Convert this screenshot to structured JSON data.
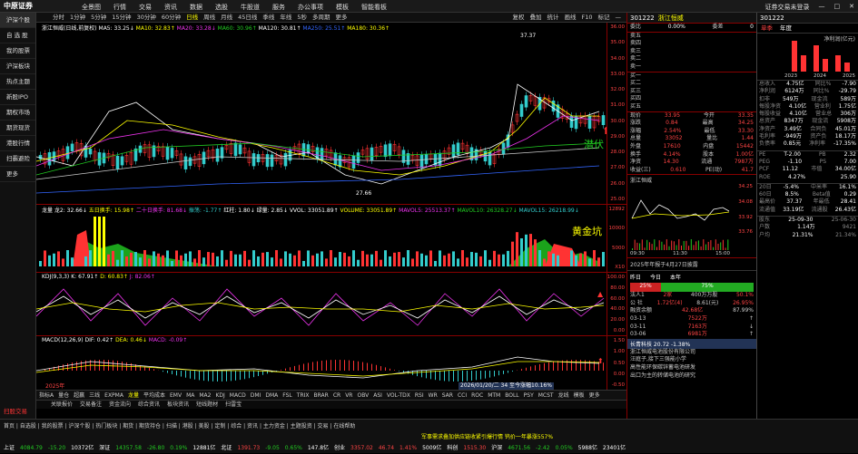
{
  "app": {
    "brand": "中原证券",
    "menu": [
      "全景图",
      "行情",
      "交易",
      "资讯",
      "数据",
      "选股",
      "牛股道",
      "服务",
      "办公事项",
      "模板",
      "智能看板"
    ],
    "right": [
      "证券交易未登录",
      "—",
      "□",
      "✕"
    ]
  },
  "sidebar": {
    "items": [
      "沪深个股",
      "自 选 股",
      "我的股票",
      "沪深板块",
      "热点主题",
      "新股IPO",
      "期权市场",
      "期货现货",
      "港股行情",
      "扫霸避险",
      "更多"
    ],
    "bottom_label": "扫股交易"
  },
  "tabs": {
    "items": [
      "分时",
      "1分钟",
      "5分钟",
      "15分钟",
      "30分钟",
      "60分钟",
      "日线",
      "周线",
      "月线",
      "45日线",
      "季线",
      "年线",
      "5秒",
      "多周期",
      "更多"
    ],
    "selected": "日线",
    "tools": [
      "复权",
      "叠加",
      "统计",
      "画线",
      "F10",
      "标记",
      "—"
    ]
  },
  "main_legend": {
    "title": "浙江恒威(日线,前复权)",
    "ma5": "MA5: 33.25↓",
    "ma10": "MA10: 32.83↑",
    "ma20": "MA20: 33.28↓",
    "ma60": "MA60: 30.96↑",
    "ma120": "MA120: 30.81↑",
    "ma250": "MA250: 25.51↑",
    "ma180": "MA180: 30.36↑"
  },
  "main_annot": {
    "high": "37.37",
    "low": "27.66",
    "label": "潜伏"
  },
  "main_axis": [
    "36.00",
    "35.00",
    "34.00",
    "33.00",
    "32.00",
    "31.00",
    "30.00",
    "29.00",
    "28.00",
    "27.00",
    "26.00",
    "25.00"
  ],
  "vol_legend": {
    "a": "龙量 龙2: 32.66↓",
    "b": "五日换手: 15.98↑",
    "c": "二十日换手: 81.68↓",
    "d": "振荡: -1.77↑",
    "e": "红柱: 1.80↓",
    "f": "绿量: 2.85↓",
    "g": "VVOL: 33051.89↑",
    "h": "VOLUME: 33051.89↑",
    "i": "MAVOL5: 25513.37↑",
    "j": "MAVOL10: 26328.27↓",
    "k": "MAVOL15: 26218.99↓"
  },
  "vol_annot": "黄金坑",
  "vol_axis": [
    "12892",
    "10000",
    "5000",
    "X10"
  ],
  "kdj_legend": {
    "t": "KDJ(9,3,3)",
    "k": "K: 67.91↑",
    "d": "D: 60.83↑",
    "j": "J: 82.06↑"
  },
  "kdj_axis": [
    "100.00",
    "80.00",
    "60.00",
    "40.00",
    "20.00",
    "0.00"
  ],
  "macd_legend": {
    "t": "MACD(12,26,9)",
    "dif": "DIF: 0.42↑",
    "dea": "DEA: 0.46↓",
    "macd": "MACD: -0.09↑"
  },
  "macd_axis": [
    "1.50",
    "1.00",
    "0.50",
    "0.00",
    "-0.50"
  ],
  "macd_note": "2026/01/20/二 34 至今涨幅10.16%",
  "date_left": "2025年",
  "bottom_tabs": [
    "指标A",
    "量仓",
    "超赢",
    "三线",
    "EXPMA",
    "龙量",
    "平均成本",
    "EMV",
    "MA",
    "MA2",
    "KDJ",
    "MACD",
    "DMI",
    "DMA",
    "FSL",
    "TRIX",
    "BRAR",
    "CR",
    "VR",
    "OBV",
    "ASI",
    "VOL-TDX",
    "RSI",
    "WR",
    "SAR",
    "CCI",
    "ROC",
    "MTM",
    "BOLL",
    "PSY",
    "MCST",
    "龙线",
    "模板",
    "更多"
  ],
  "bottom_selected": "龙量",
  "strip": [
    "关联报价",
    "交易备注",
    "资金流向",
    "综合资讯",
    "板块资讯",
    "短线题材",
    "扫雷宝"
  ],
  "ticker": "军事需求叠加供应链收紧引爆行情 钨价一年暴涨557%",
  "status_row1": [
    {
      "t": "上证",
      "c": "wht"
    },
    {
      "t": "4084.79",
      "c": "dn"
    },
    {
      "t": "-15.20",
      "c": "dn"
    },
    {
      "t": "10372亿",
      "c": "wht"
    },
    {
      "t": "深证",
      "c": "wht"
    },
    {
      "t": "14357.58",
      "c": "dn"
    },
    {
      "t": "-26.80",
      "c": "dn"
    },
    {
      "t": "0.19%",
      "c": "dn"
    },
    {
      "t": "12881亿",
      "c": "wht"
    },
    {
      "t": "北证",
      "c": "wht"
    },
    {
      "t": "1391.73",
      "c": "up"
    },
    {
      "t": "-9.05",
      "c": "dn"
    },
    {
      "t": "0.65%",
      "c": "dn"
    },
    {
      "t": "147.8亿",
      "c": "wht"
    },
    {
      "t": "创业",
      "c": "wht"
    },
    {
      "t": "3357.02",
      "c": "up"
    },
    {
      "t": "46.74",
      "c": "up"
    },
    {
      "t": "1.41%",
      "c": "up"
    },
    {
      "t": "5009亿",
      "c": "wht"
    },
    {
      "t": "科创",
      "c": "wht"
    },
    {
      "t": "1515.30",
      "c": "up"
    },
    {
      "t": "沪深",
      "c": "wht"
    },
    {
      "t": "4671.56",
      "c": "dn"
    },
    {
      "t": "-2.42",
      "c": "dn"
    },
    {
      "t": "0.05%",
      "c": "dn"
    },
    {
      "t": "5988亿",
      "c": "wht"
    },
    {
      "t": "23401亿",
      "c": "wht"
    }
  ],
  "status_row2": "首页 | 自选股 | 我的股票 | 沪深个股 | 热门板块 | 期货 | 期货持仓 | 扫描 | 港股 | 美股 | 定制 | 综合 | 资讯 | 主力资金 | 主题投资 | 交易 | 在线帮助",
  "quote": {
    "code": "301222",
    "name": "浙江恒威",
    "wei_label": "委比",
    "wei_val": "0.00%",
    "wei_cha_label": "委差",
    "wei_cha_val": "0",
    "sells": [
      [
        "卖五",
        "",
        ""
      ],
      [
        "卖四",
        "",
        ""
      ],
      [
        "卖三",
        "",
        ""
      ],
      [
        "卖二",
        "",
        ""
      ],
      [
        "卖一",
        "",
        ""
      ]
    ],
    "buys": [
      [
        "买一",
        "",
        ""
      ],
      [
        "买二",
        "",
        ""
      ],
      [
        "买三",
        "",
        ""
      ],
      [
        "买四",
        "",
        ""
      ],
      [
        "买五",
        "",
        ""
      ]
    ],
    "stats": [
      [
        "现价",
        "33.95",
        "今开",
        "33.35"
      ],
      [
        "涨跌",
        "0.84",
        "最高",
        "34.25"
      ],
      [
        "涨幅",
        "2.54%",
        "最低",
        "33.30"
      ],
      [
        "总量",
        "33052",
        "量比",
        "1.44"
      ],
      [
        "外盘",
        "17610",
        "内盘",
        "15442"
      ],
      [
        "换手",
        "4.14%",
        "股本",
        "1.00亿"
      ],
      [
        "净资",
        "14.30",
        "流通",
        "7987万"
      ],
      [
        "收益(三)",
        "0.610",
        "PE(动)",
        "41.7"
      ]
    ],
    "mini_title": "浙江恒威",
    "mini_axis": [
      "34.25",
      "34.08",
      "33.92",
      "33.76"
    ],
    "time_axis": [
      "09:30",
      "11:30",
      "15:00"
    ],
    "broker": "2025年年报于4月27日披露",
    "gain_label": "昨日",
    "gain_vals": [
      "今日",
      "本年"
    ],
    "bull": "25%",
    "bear": "75%",
    "bull_count": "1人",
    "bear_count": "3人",
    "lhb": [
      [
        "法人1",
        "2家",
        "400万万股",
        "50.1%"
      ],
      [
        "公 社",
        "1.72亿(4)",
        "8.61(元)",
        "26.95%"
      ],
      [
        "融资余额",
        "42.68亿",
        "87.99%"
      ]
    ],
    "dates": [
      [
        "03-13",
        "7522万",
        "↑"
      ],
      [
        "03-11",
        "7163万",
        "↓"
      ],
      [
        "03-06",
        "6981万",
        "↑"
      ]
    ],
    "related": "长青科技 20.72 -1.38%",
    "news": [
      "浙江恒威电池股份有限公司",
      "汪庭子,接下三强能小学",
      "高性能环保碳锌蓄电池研发",
      "出口为主的转储电池的研究"
    ]
  },
  "fund": {
    "code": "301222",
    "tabs": [
      "单季",
      "年度"
    ],
    "chart_title": "净利润(亿元)",
    "years": [
      "2023",
      "2024",
      "2025"
    ],
    "rows": [
      [
        "总收入",
        "4.75亿",
        "同比%",
        "-7.90"
      ],
      [
        "净利润",
        "6124万",
        "同比%",
        "-29.79"
      ],
      [
        "扣非",
        "549万",
        "现金流",
        "589万"
      ],
      [
        "每股净资",
        "4.10亿",
        "营业利",
        "1.75亿"
      ],
      [
        "每股收益",
        "4.10亿",
        "营业总",
        "306万"
      ],
      [
        "总资产",
        "8347万",
        "现金流",
        "5908万"
      ],
      [
        "净资产",
        "3.49亿",
        "合同负",
        "45.01万"
      ],
      [
        "毛利率",
        "-949万",
        "资产负",
        "18.17万"
      ],
      [
        "负债率",
        "0.85元",
        "净利率",
        "-17.35%"
      ]
    ],
    "val": [
      [
        "PE",
        "T-2.00",
        "PB",
        "2.32"
      ],
      [
        "PEG",
        "-1.10",
        "PS",
        "7.00"
      ],
      [
        "PCF",
        "11.12",
        "市值",
        "34.00亿"
      ],
      [
        "ROE",
        "4.27%",
        "",
        "25.90"
      ]
    ],
    "ind": [
      [
        "20日",
        "-5.4%",
        "中米率",
        "16.1%"
      ],
      [
        "60日",
        "8.5%",
        "Beta值",
        "0.29"
      ],
      [
        "最高价",
        "37.37",
        "年最低",
        "28.41"
      ],
      [
        "流通值",
        "33.19亿",
        "流通股",
        "26.43亿"
      ]
    ],
    "holders": [
      [
        "股东",
        "25-09-30",
        "25-06-30"
      ],
      [
        "户数",
        "1.14万",
        "9421"
      ],
      [
        "户均",
        "21.31%",
        "21.34%"
      ]
    ]
  }
}
